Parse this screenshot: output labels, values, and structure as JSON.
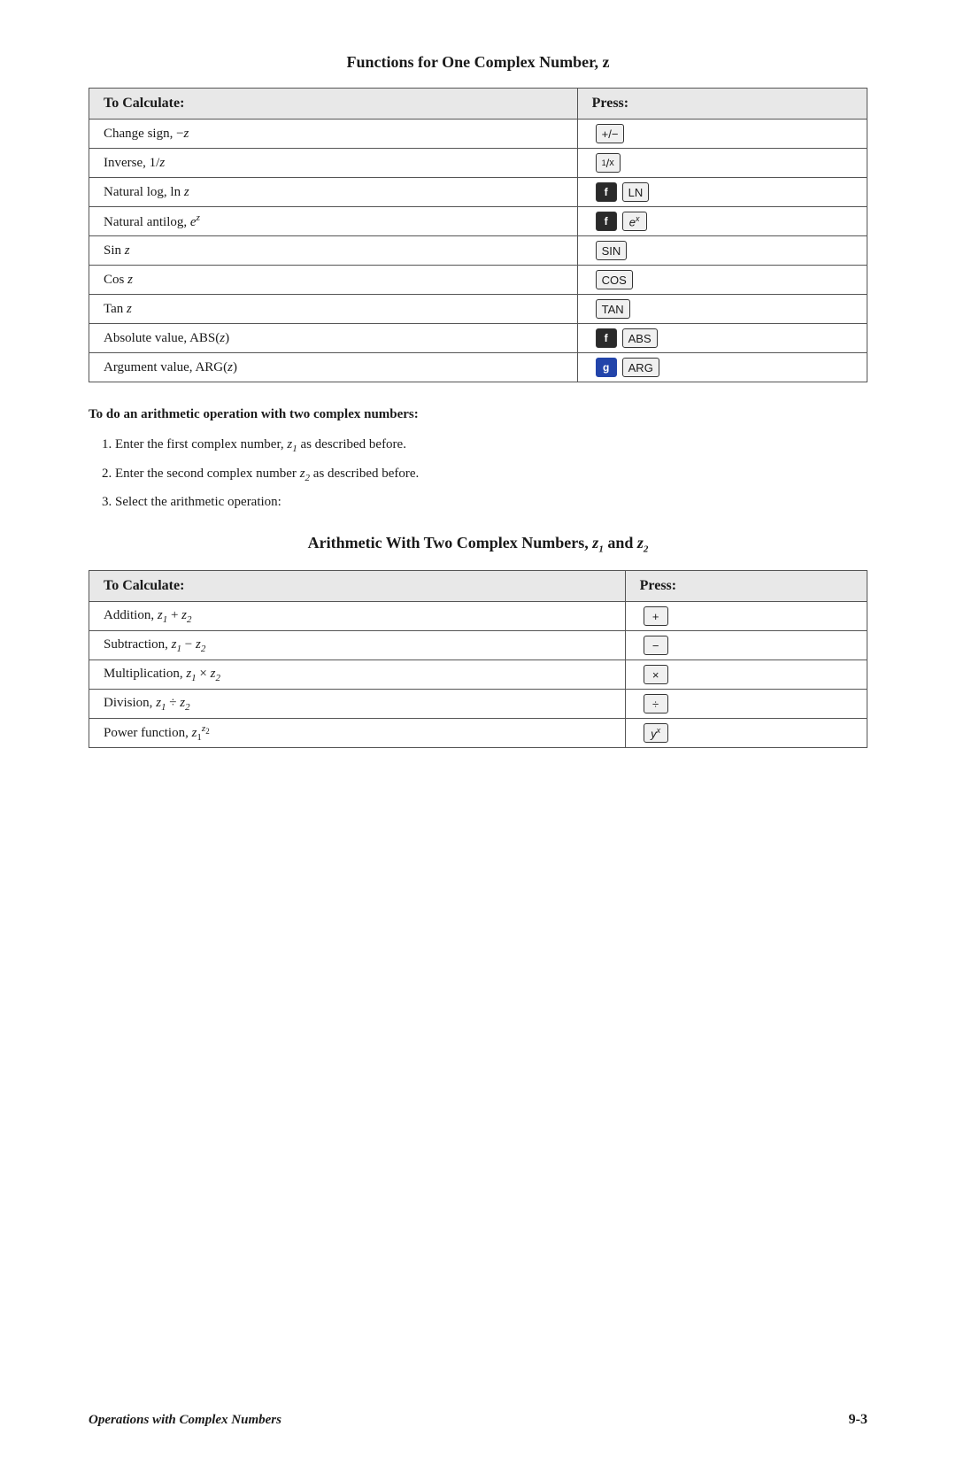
{
  "page": {
    "main_title": "Functions for One Complex Number, z",
    "table1": {
      "col1_header": "To Calculate:",
      "col2_header": "Press:",
      "rows": [
        {
          "calc": "Change sign, −z",
          "press_type": "key",
          "key_label": "+/−"
        },
        {
          "calc": "Inverse, 1/z",
          "press_type": "key",
          "key_label": "1/x"
        },
        {
          "calc": "Natural log, ln z",
          "press_type": "shift_key",
          "shift": "f",
          "key_label": "LN"
        },
        {
          "calc": "Natural antilog, e^z",
          "press_type": "shift_key",
          "shift": "f",
          "key_label": "eˣ"
        },
        {
          "calc": "Sin z",
          "press_type": "key",
          "key_label": "SIN"
        },
        {
          "calc": "Cos z",
          "press_type": "key",
          "key_label": "COS"
        },
        {
          "calc": "Tan z",
          "press_type": "key",
          "key_label": "TAN"
        },
        {
          "calc": "Absolute value, ABS(z)",
          "press_type": "shift_key",
          "shift": "f",
          "key_label": "ABS"
        },
        {
          "calc": "Argument value, ARG(z)",
          "press_type": "shift_key2",
          "shift": "g",
          "key_label": "ARG"
        }
      ]
    },
    "bold_instruction": "To do an arithmetic operation with two complex numbers:",
    "steps": [
      "Enter the first complex number, z₁ as described before.",
      "Enter the second complex number z₂ as described before.",
      "Select the arithmetic operation:"
    ],
    "second_title": "Arithmetic With Two Complex Numbers, z₁ and z₂",
    "table2": {
      "col1_header": "To Calculate:",
      "col2_header": "Press:",
      "rows": [
        {
          "calc": "Addition, z₁ + z₂",
          "press_type": "key",
          "key_label": "+"
        },
        {
          "calc": "Subtraction, z₁ − z₂",
          "press_type": "key",
          "key_label": "−"
        },
        {
          "calc": "Multiplication, z₁ × z₂",
          "press_type": "key",
          "key_label": "×"
        },
        {
          "calc": "Division, z₁ ÷ z₂",
          "press_type": "key",
          "key_label": "÷"
        },
        {
          "calc": "Power function, z₁^z₂",
          "press_type": "key",
          "key_label": "yˣ"
        }
      ]
    },
    "footer": {
      "left": "Operations with Complex Numbers",
      "right": "9-3"
    }
  }
}
